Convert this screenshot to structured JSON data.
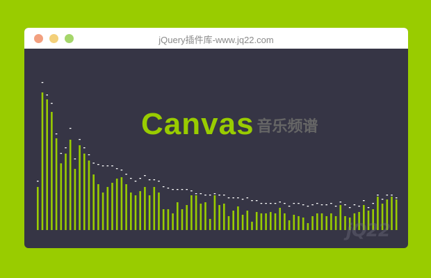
{
  "window": {
    "title": "jQuery插件库-www.jq22.com"
  },
  "heading": {
    "main": "Canvas",
    "sub": "音乐频谱"
  },
  "watermark": {
    "text": "jQ22"
  },
  "colors": {
    "background": "#99cc00",
    "panel": "#363545",
    "bar": "#99cc00",
    "cap": "#ffffff"
  },
  "spectrum": {
    "scale_max": 1.0,
    "levels": [
      0.31,
      0.99,
      0.94,
      0.85,
      0.66,
      0.48,
      0.55,
      0.65,
      0.44,
      0.61,
      0.55,
      0.5,
      0.4,
      0.33,
      0.27,
      0.31,
      0.34,
      0.37,
      0.38,
      0.33,
      0.27,
      0.25,
      0.28,
      0.31,
      0.25,
      0.31,
      0.27,
      0.15,
      0.15,
      0.12,
      0.2,
      0.15,
      0.18,
      0.25,
      0.25,
      0.19,
      0.2,
      0.08,
      0.25,
      0.18,
      0.19,
      0.1,
      0.14,
      0.17,
      0.11,
      0.14,
      0.06,
      0.13,
      0.12,
      0.12,
      0.13,
      0.12,
      0.16,
      0.12,
      0.07,
      0.11,
      0.1,
      0.09,
      0.05,
      0.1,
      0.12,
      0.12,
      0.1,
      0.12,
      0.1,
      0.18,
      0.1,
      0.09,
      0.12,
      0.13,
      0.18,
      0.14,
      0.15,
      0.24,
      0.19,
      0.22,
      0.24,
      0.22
    ],
    "caps": [
      0.34,
      1.05,
      0.96,
      0.9,
      0.68,
      0.54,
      0.58,
      0.72,
      0.5,
      0.64,
      0.58,
      0.53,
      0.47,
      0.46,
      0.45,
      0.45,
      0.45,
      0.43,
      0.42,
      0.39,
      0.36,
      0.34,
      0.36,
      0.38,
      0.35,
      0.35,
      0.34,
      0.3,
      0.29,
      0.28,
      0.28,
      0.28,
      0.28,
      0.27,
      0.25,
      0.25,
      0.24,
      0.24,
      0.25,
      0.24,
      0.24,
      0.22,
      0.22,
      0.22,
      0.21,
      0.22,
      0.2,
      0.2,
      0.18,
      0.18,
      0.18,
      0.18,
      0.19,
      0.18,
      0.16,
      0.18,
      0.18,
      0.17,
      0.16,
      0.17,
      0.18,
      0.17,
      0.17,
      0.18,
      0.16,
      0.19,
      0.17,
      0.15,
      0.17,
      0.16,
      0.2,
      0.15,
      0.18,
      0.24,
      0.21,
      0.24,
      0.24,
      0.22
    ]
  }
}
